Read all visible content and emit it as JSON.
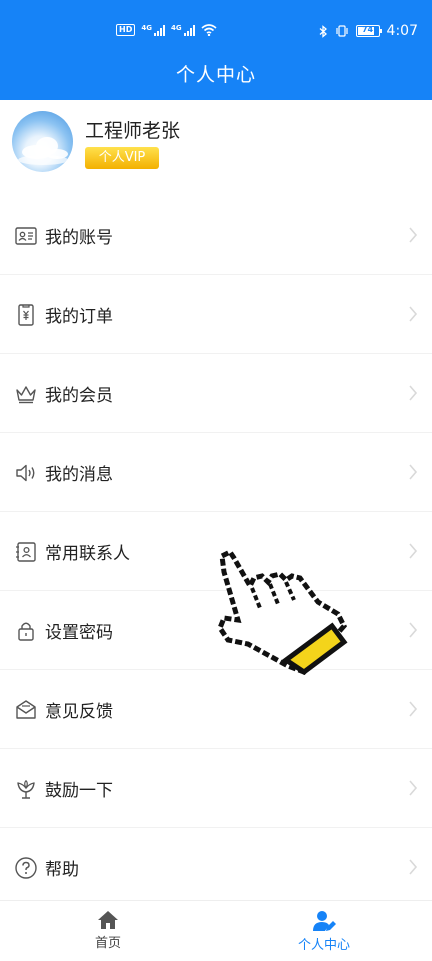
{
  "status_bar": {
    "hd_label": "HD",
    "signal1_label": "4G",
    "signal2_label": "4G",
    "battery_level": "74",
    "time": "4:07"
  },
  "header": {
    "title": "个人中心"
  },
  "profile": {
    "username": "工程师老张",
    "vip_label": "个人VIP"
  },
  "menu": {
    "items": [
      {
        "label": "我的账号",
        "icon": "id-card-icon"
      },
      {
        "label": "我的订单",
        "icon": "order-receipt-icon"
      },
      {
        "label": "我的会员",
        "icon": "crown-icon"
      },
      {
        "label": "我的消息",
        "icon": "speaker-icon"
      },
      {
        "label": "常用联系人",
        "icon": "contact-card-icon"
      },
      {
        "label": "设置密码",
        "icon": "lock-icon"
      },
      {
        "label": "意见反馈",
        "icon": "envelope-icon"
      },
      {
        "label": "鼓励一下",
        "icon": "flower-icon"
      },
      {
        "label": "帮助",
        "icon": "help-icon"
      }
    ]
  },
  "bottom_nav": {
    "tabs": [
      {
        "label": "首页",
        "icon": "home-icon",
        "active": false
      },
      {
        "label": "个人中心",
        "icon": "person-edit-icon",
        "active": true
      }
    ]
  },
  "colors": {
    "brand": "#1683f7",
    "vip_gold": "#f3b000",
    "text": "#222222",
    "chevron": "#d9d9d9"
  }
}
